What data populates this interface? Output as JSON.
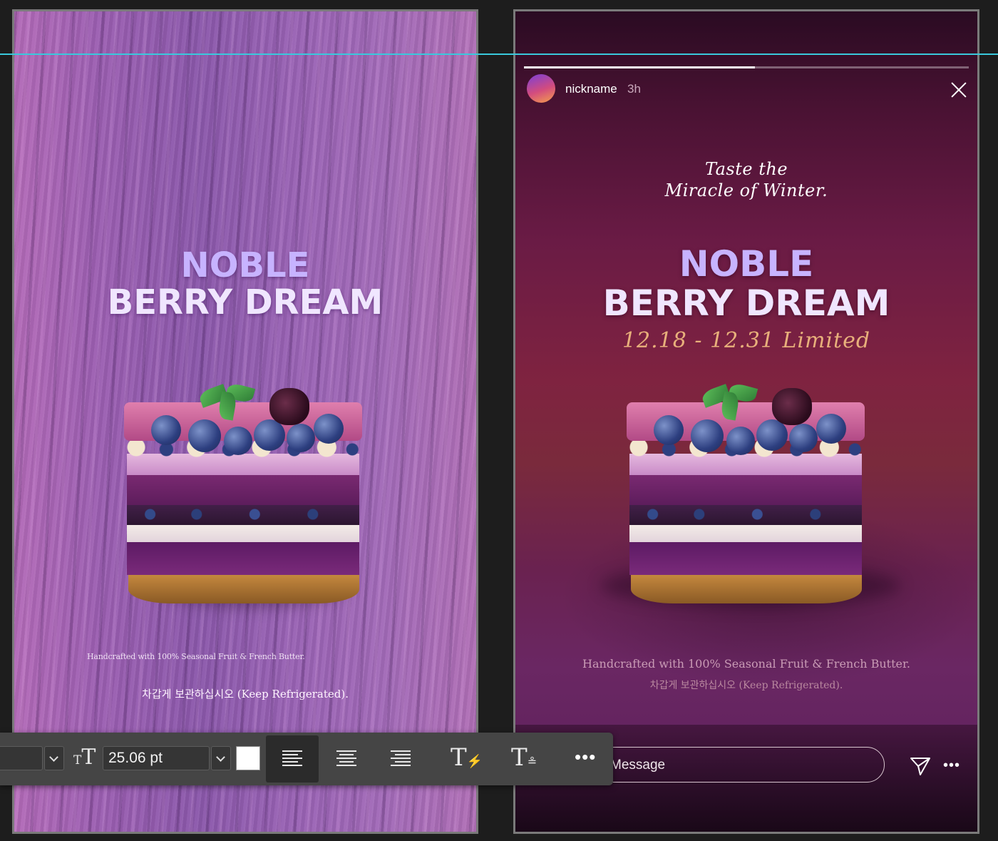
{
  "left_artboard": {
    "title_line1": "NOBLE",
    "title_line2": "BERRY DREAM",
    "note": "Handcrafted with 100% Seasonal Fruit & French Butter.",
    "keep": "차갑게 보관하십시오 (Keep Refrigerated)."
  },
  "story": {
    "username": "nickname",
    "time_ago": "3h",
    "progress": 0.52,
    "tagline_line1": "Taste the",
    "tagline_line2": "Miracle of Winter.",
    "title_line1": "NOBLE",
    "title_line2": "BERRY DREAM",
    "limited": "12.18 - 12.31 Limited",
    "note": "Handcrafted with 100% Seasonal Fruit & French Butter.",
    "keep": "차갑게 보관하십시오 (Keep Refrigerated).",
    "message_placeholder": "Message",
    "icons": [
      "close-icon",
      "send-icon",
      "more-icon"
    ]
  },
  "toolbar": {
    "font_size": "25.06 pt",
    "text_color": "#ffffff",
    "icons": [
      "font-size-icon",
      "align-left-icon",
      "align-center-icon",
      "align-right-icon",
      "text-warp-icon",
      "text-options-icon",
      "more-icon"
    ],
    "active_alignment": "left"
  },
  "colors": {
    "guide": "#39c9dc",
    "title_lavender": "#c7b3ff",
    "limited_gold": "#e8b07b"
  }
}
